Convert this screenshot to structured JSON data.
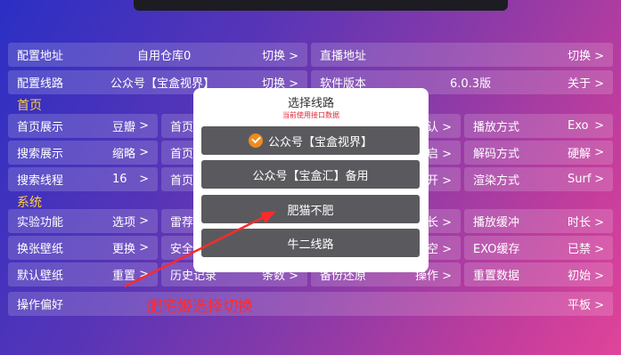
{
  "rows": {
    "r1a": {
      "label": "配置地址",
      "value": "自用仓库0",
      "action": "切换 >"
    },
    "r1b": {
      "label": "直播地址",
      "action": "切换 >"
    },
    "r2a": {
      "label": "配置线路",
      "value": "公众号【宝盒视界】",
      "action": "切换 >"
    },
    "r2b": {
      "label": "软件版本",
      "value": "6.0.3版",
      "action": "关于 >"
    },
    "r3a": {
      "label": "首页展示",
      "value": "豆瓣",
      "action": ">"
    },
    "r3b": {
      "label": "首页"
    },
    "r3c": {
      "action": "认 >"
    },
    "r3d": {
      "label": "播放方式",
      "value": "Exo",
      "action": ">"
    },
    "r4a": {
      "label": "搜索展示",
      "value": "缩略",
      "action": ">"
    },
    "r4b": {
      "label": "首页"
    },
    "r4c": {
      "action": "启 >"
    },
    "r4d": {
      "label": "解码方式",
      "value": "硬解",
      "action": ">"
    },
    "r5a": {
      "label": "搜索线程",
      "value": "16",
      "action": ">"
    },
    "r5b": {
      "label": "首页"
    },
    "r5c": {
      "action": "开 >"
    },
    "r5d": {
      "label": "渲染方式",
      "value": "Surf",
      "action": ">"
    },
    "r6a": {
      "label": "实验功能",
      "value": "选项",
      "action": ">"
    },
    "r6b": {
      "label": "雷荐"
    },
    "r6c": {
      "action": "长 >"
    },
    "r6d": {
      "label": "播放缓冲",
      "action": "时长 >"
    },
    "r7a": {
      "label": "换张壁纸",
      "value": "更换",
      "action": ">"
    },
    "r7b": {
      "label": "安全"
    },
    "r7c": {
      "action": "空 >"
    },
    "r7d": {
      "label": "EXO缓存",
      "action": "已禁 >"
    },
    "r8a": {
      "label": "默认壁纸",
      "value": "重置",
      "action": ">"
    },
    "r8b": {
      "label": "历史记录",
      "action": "条数 >"
    },
    "r8c": {
      "label": "备份还原",
      "action": "操作 >"
    },
    "r8d": {
      "label": "重置数据",
      "action": "初始 >"
    },
    "r9": {
      "label": "操作偏好",
      "action": "平板 >"
    }
  },
  "sections": {
    "home": "首页",
    "system": "系统"
  },
  "dialog": {
    "title": "选择线路",
    "subtitle": "当前使用接口数据",
    "options": [
      "公众号【宝盒视界】",
      "公众号【宝盒汇】备用",
      "肥猫不肥",
      "牛二线路"
    ],
    "selected_index": 0
  },
  "annotation": {
    "text": "肥宅姬选择切换",
    "color": "#ff2a2a"
  }
}
